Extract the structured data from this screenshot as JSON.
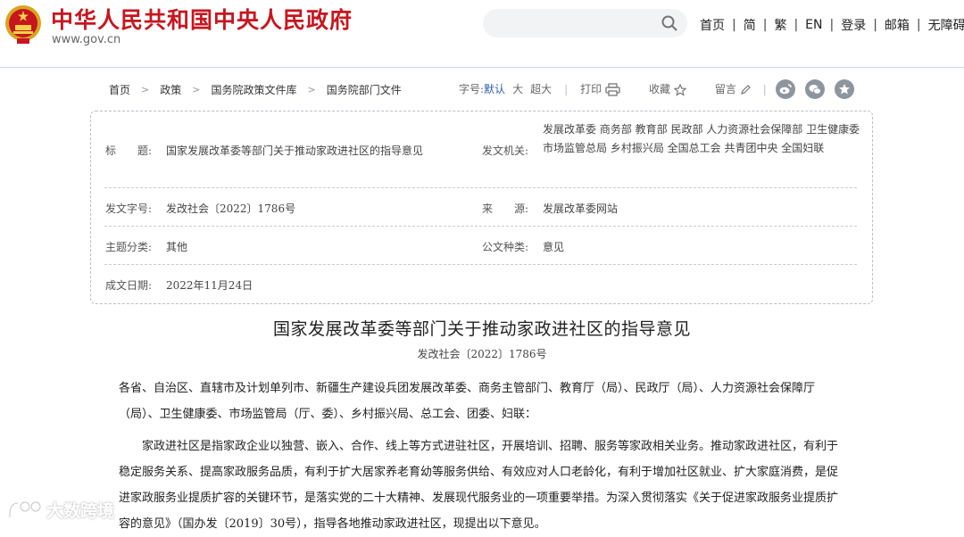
{
  "header": {
    "site_title": "中华人民共和国中央人民政府",
    "site_url": "www.gov.cn",
    "search_placeholder": "",
    "nav": [
      "首页",
      "简",
      "繁",
      "EN",
      "登录",
      "邮箱",
      "无障碍"
    ]
  },
  "breadcrumb": [
    "首页",
    "政策",
    "国务院政策文件库",
    "国务院部门文件"
  ],
  "toolbar": {
    "font_label": "字号:",
    "font_default": "默认",
    "font_large": "大",
    "font_xlarge": "超大",
    "print": "打印",
    "favorite": "收藏",
    "comment": "留言"
  },
  "info": {
    "title_label": "标　　题:",
    "title_value": "国家发展改革委等部门关于推动家政进社区的指导意见",
    "issuer_label": "发文机关:",
    "issuer_value": "发展改革委 商务部 教育部 民政部 人力资源社会保障部 卫生健康委 市场监管总局 乡村振兴局 全国总工会 共青团中央 全国妇联",
    "docno_label": "发文字号:",
    "docno_value": "发改社会〔2022〕1786号",
    "source_label": "来　　源:",
    "source_value": "发展改革委网站",
    "topic_label": "主题分类:",
    "topic_value": "其他",
    "type_label": "公文种类:",
    "type_value": "意见",
    "date_label": "成文日期:",
    "date_value": "2022年11月24日"
  },
  "article": {
    "title": "国家发展改革委等部门关于推动家政进社区的指导意见",
    "doc_number": "发改社会〔2022〕1786号",
    "addressee": "各省、自治区、直辖市及计划单列市、新疆生产建设兵团发展改革委、商务主管部门、教育厅（局）、民政厅（局）、人力资源社会保障厅（局）、卫生健康委、市场监管局（厅、委）、乡村振兴局、总工会、团委、妇联：",
    "paragraph1": "家政进社区是指家政企业以独营、嵌入、合作、线上等方式进驻社区，开展培训、招聘、服务等家政相关业务。推动家政进社区，有利于稳定服务关系、提高家政服务品质，有利于扩大居家养老育幼等服务供给、有效应对人口老龄化，有利于增加社区就业、扩大家庭消费，是促进家政服务业提质扩容的关键环节，是落实党的二十大精神、发展现代服务业的一项重要举措。为深入贯彻落实《关于促进家政服务业提质扩容的意见》（国办发〔2019〕30号），指导各地推动家政进社区，现提出以下意见。"
  },
  "watermark": "大数跨境",
  "colors": {
    "brand_red": "#c7161e",
    "link_blue": "#2c5fb2"
  }
}
